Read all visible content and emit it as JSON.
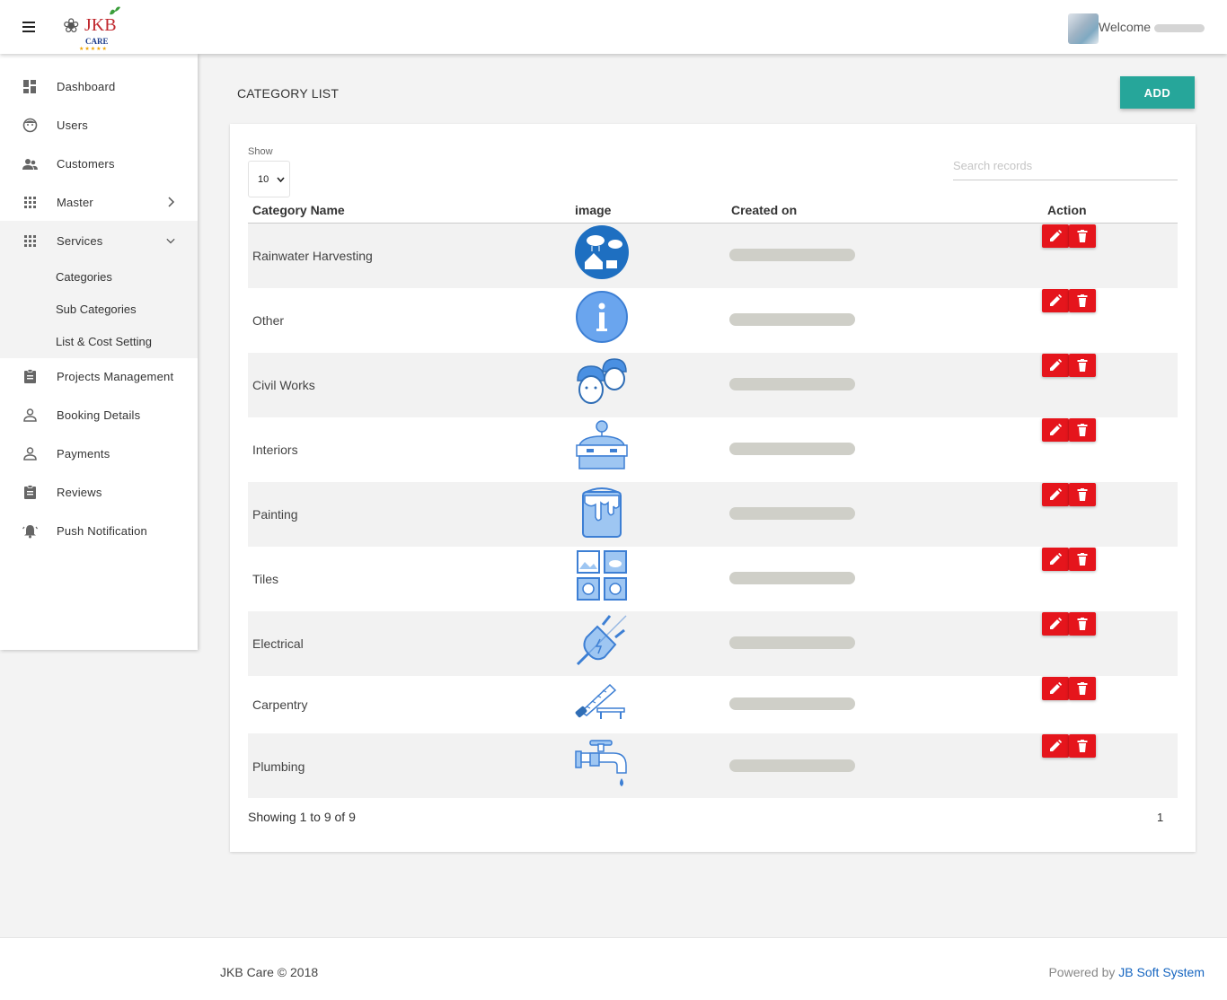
{
  "header": {
    "logo_text": "JKB",
    "logo_sub": "CARE",
    "welcome": "Welcome"
  },
  "sidebar": {
    "items": [
      {
        "label": "Dashboard",
        "icon": "dashboard-icon"
      },
      {
        "label": "Users",
        "icon": "face-icon"
      },
      {
        "label": "Customers",
        "icon": "people-icon"
      },
      {
        "label": "Master",
        "icon": "grid-icon"
      },
      {
        "label": "Services",
        "icon": "grid-icon"
      },
      {
        "label": "Projects Management",
        "icon": "clipboard-icon"
      },
      {
        "label": "Booking Details",
        "icon": "person-icon"
      },
      {
        "label": "Payments",
        "icon": "person-icon"
      },
      {
        "label": "Reviews",
        "icon": "clipboard-icon"
      },
      {
        "label": "Push Notification",
        "icon": "bell-icon"
      }
    ],
    "services_sub": [
      "Categories",
      "Sub Categories",
      "List & Cost Setting"
    ]
  },
  "main": {
    "title": "CATEGORY LIST",
    "add_label": "ADD",
    "show_label": "Show",
    "show_value": "10",
    "search_placeholder": "Search records",
    "columns": [
      "Category Name",
      "image",
      "Created on",
      "Action"
    ],
    "rows": [
      {
        "name": "Rainwater Harvesting",
        "icon": "rainwater-icon"
      },
      {
        "name": "Other",
        "icon": "info-icon"
      },
      {
        "name": "Civil Works",
        "icon": "worker-icon"
      },
      {
        "name": "Interiors",
        "icon": "interiors-icon"
      },
      {
        "name": "Painting",
        "icon": "paint-bucket-icon"
      },
      {
        "name": "Tiles",
        "icon": "tiles-icon"
      },
      {
        "name": "Electrical",
        "icon": "plug-icon"
      },
      {
        "name": "Carpentry",
        "icon": "saw-icon"
      },
      {
        "name": "Plumbing",
        "icon": "faucet-icon"
      }
    ],
    "showing": "Showing 1 to 9 of 9",
    "page": "1"
  },
  "footer": {
    "copyright": "JKB Care © 2018",
    "powered_prefix": "Powered by",
    "powered_link": "JB Soft System"
  },
  "colors": {
    "accent": "#26a69a",
    "danger": "#e5151c",
    "icon_blue": "#4a90e2",
    "link": "#1565c0"
  }
}
